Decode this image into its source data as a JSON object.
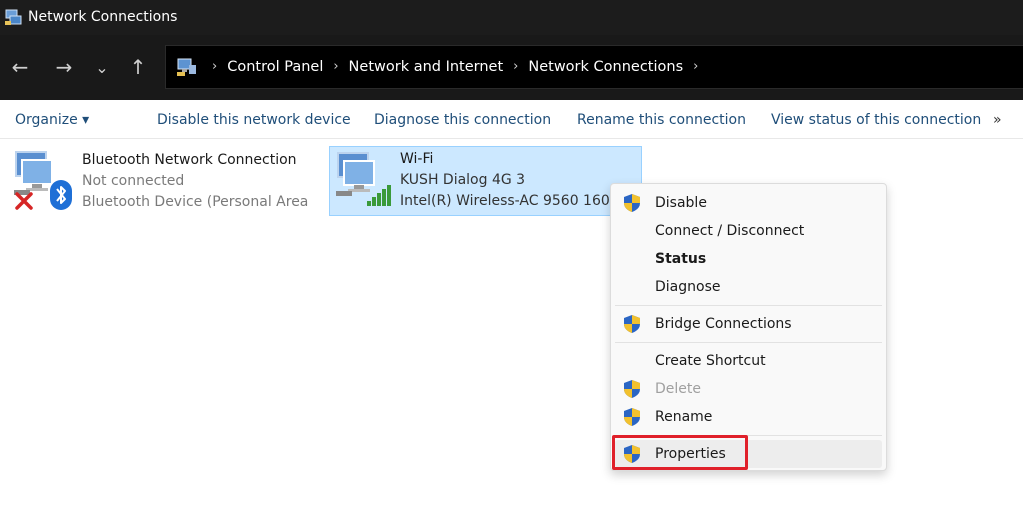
{
  "window": {
    "title": "Network Connections"
  },
  "nav": {
    "back": "←",
    "forward": "→",
    "recent": "⌄",
    "up": "↑"
  },
  "breadcrumb": [
    "Control Panel",
    "Network and Internet",
    "Network Connections"
  ],
  "commands": {
    "organize": "Organize ▾",
    "disable": "Disable this network device",
    "diagnose": "Diagnose this connection",
    "rename": "Rename this connection",
    "view_status": "View status of this connection",
    "more": "»"
  },
  "connections": [
    {
      "name": "Bluetooth Network Connection",
      "status": "Not connected",
      "device": "Bluetooth Device (Personal Area"
    },
    {
      "name": "Wi-Fi",
      "status": "KUSH Dialog 4G 3",
      "device": "Intel(R) Wireless-AC 9560 160MHz"
    }
  ],
  "context_menu": {
    "disable": "Disable",
    "connect": "Connect / Disconnect",
    "status": "Status",
    "diagnose": "Diagnose",
    "bridge": "Bridge Connections",
    "shortcut": "Create Shortcut",
    "delete": "Delete",
    "rename": "Rename",
    "properties": "Properties"
  },
  "colors": {
    "titlebar": "#1c1c1c",
    "selection": "#cce8ff",
    "highlight": "#e0202a",
    "link": "#1f4e79"
  }
}
